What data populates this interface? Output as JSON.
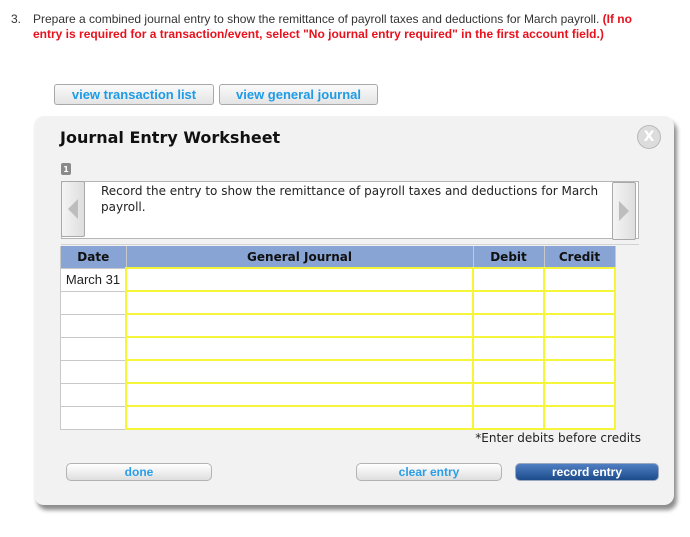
{
  "question": {
    "number": "3.",
    "text": "Prepare a combined journal entry to show the remittance of payroll taxes and deductions for March payroll.",
    "warning": "(If no entry is required for a transaction/event, select \"No journal entry required\" in the first account field.)"
  },
  "top_buttons": {
    "view_transaction_list": "view transaction list",
    "view_general_journal": "view general journal"
  },
  "worksheet": {
    "title": "Journal Entry Worksheet",
    "close_glyph": "X",
    "current_tab": "1",
    "instruction": "Record the entry to show the remittance of payroll taxes and deductions for March payroll.",
    "table": {
      "headers": [
        "Date",
        "General Journal",
        "Debit",
        "Credit"
      ],
      "rows": [
        {
          "date": "March 31",
          "account": "",
          "debit": "",
          "credit": ""
        },
        {
          "date": "",
          "account": "",
          "debit": "",
          "credit": ""
        },
        {
          "date": "",
          "account": "",
          "debit": "",
          "credit": ""
        },
        {
          "date": "",
          "account": "",
          "debit": "",
          "credit": ""
        },
        {
          "date": "",
          "account": "",
          "debit": "",
          "credit": ""
        },
        {
          "date": "",
          "account": "",
          "debit": "",
          "credit": ""
        },
        {
          "date": "",
          "account": "",
          "debit": "",
          "credit": ""
        }
      ]
    },
    "note": "*Enter debits before credits",
    "buttons": {
      "done": "done",
      "clear_entry": "clear entry",
      "record_entry": "record entry"
    }
  },
  "colors": {
    "warning_red": "#e8121d",
    "link_blue": "#1e9be6",
    "header_blue": "#87a4d4",
    "input_yellow": "#f5f53a",
    "record_button": "#1d4c8c"
  }
}
